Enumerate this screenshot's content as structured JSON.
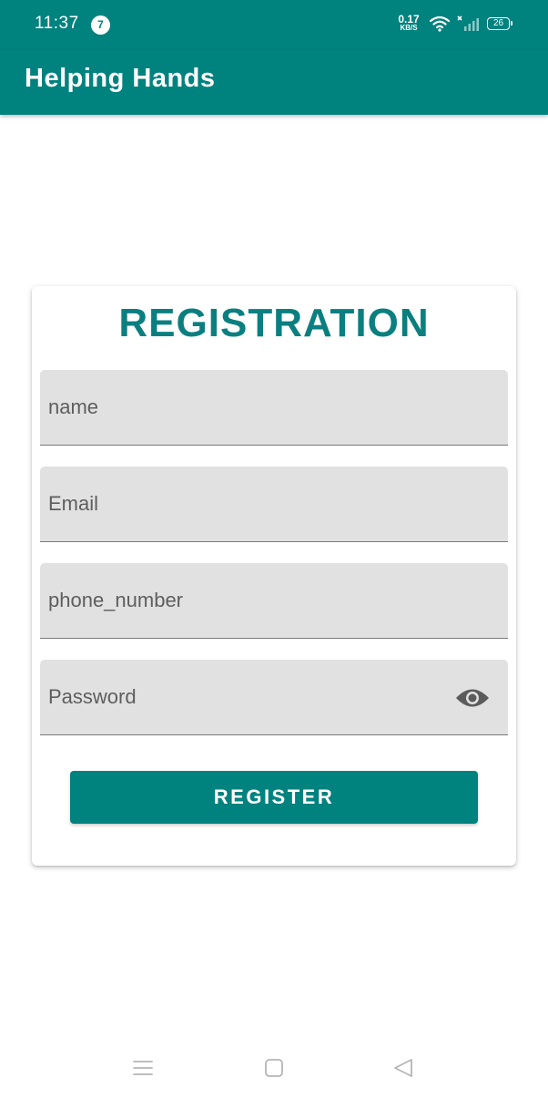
{
  "status_bar": {
    "time": "11:37",
    "notification_count": "7",
    "net_speed_value": "0.17",
    "net_speed_unit": "KB/S",
    "battery_level": "26"
  },
  "app_bar": {
    "title": "Helping Hands"
  },
  "form": {
    "title": "REGISTRATION",
    "name_placeholder": "name",
    "email_placeholder": "Email",
    "phone_placeholder": "phone_number",
    "password_placeholder": "Password",
    "register_label": "REGISTER"
  },
  "colors": {
    "primary": "#00827f",
    "title_text": "#0b7f80",
    "field_background": "#e1e1e1"
  },
  "icons": {
    "password_toggle": "eye-icon",
    "nav": [
      "menu-icon",
      "home-icon",
      "back-icon"
    ]
  }
}
